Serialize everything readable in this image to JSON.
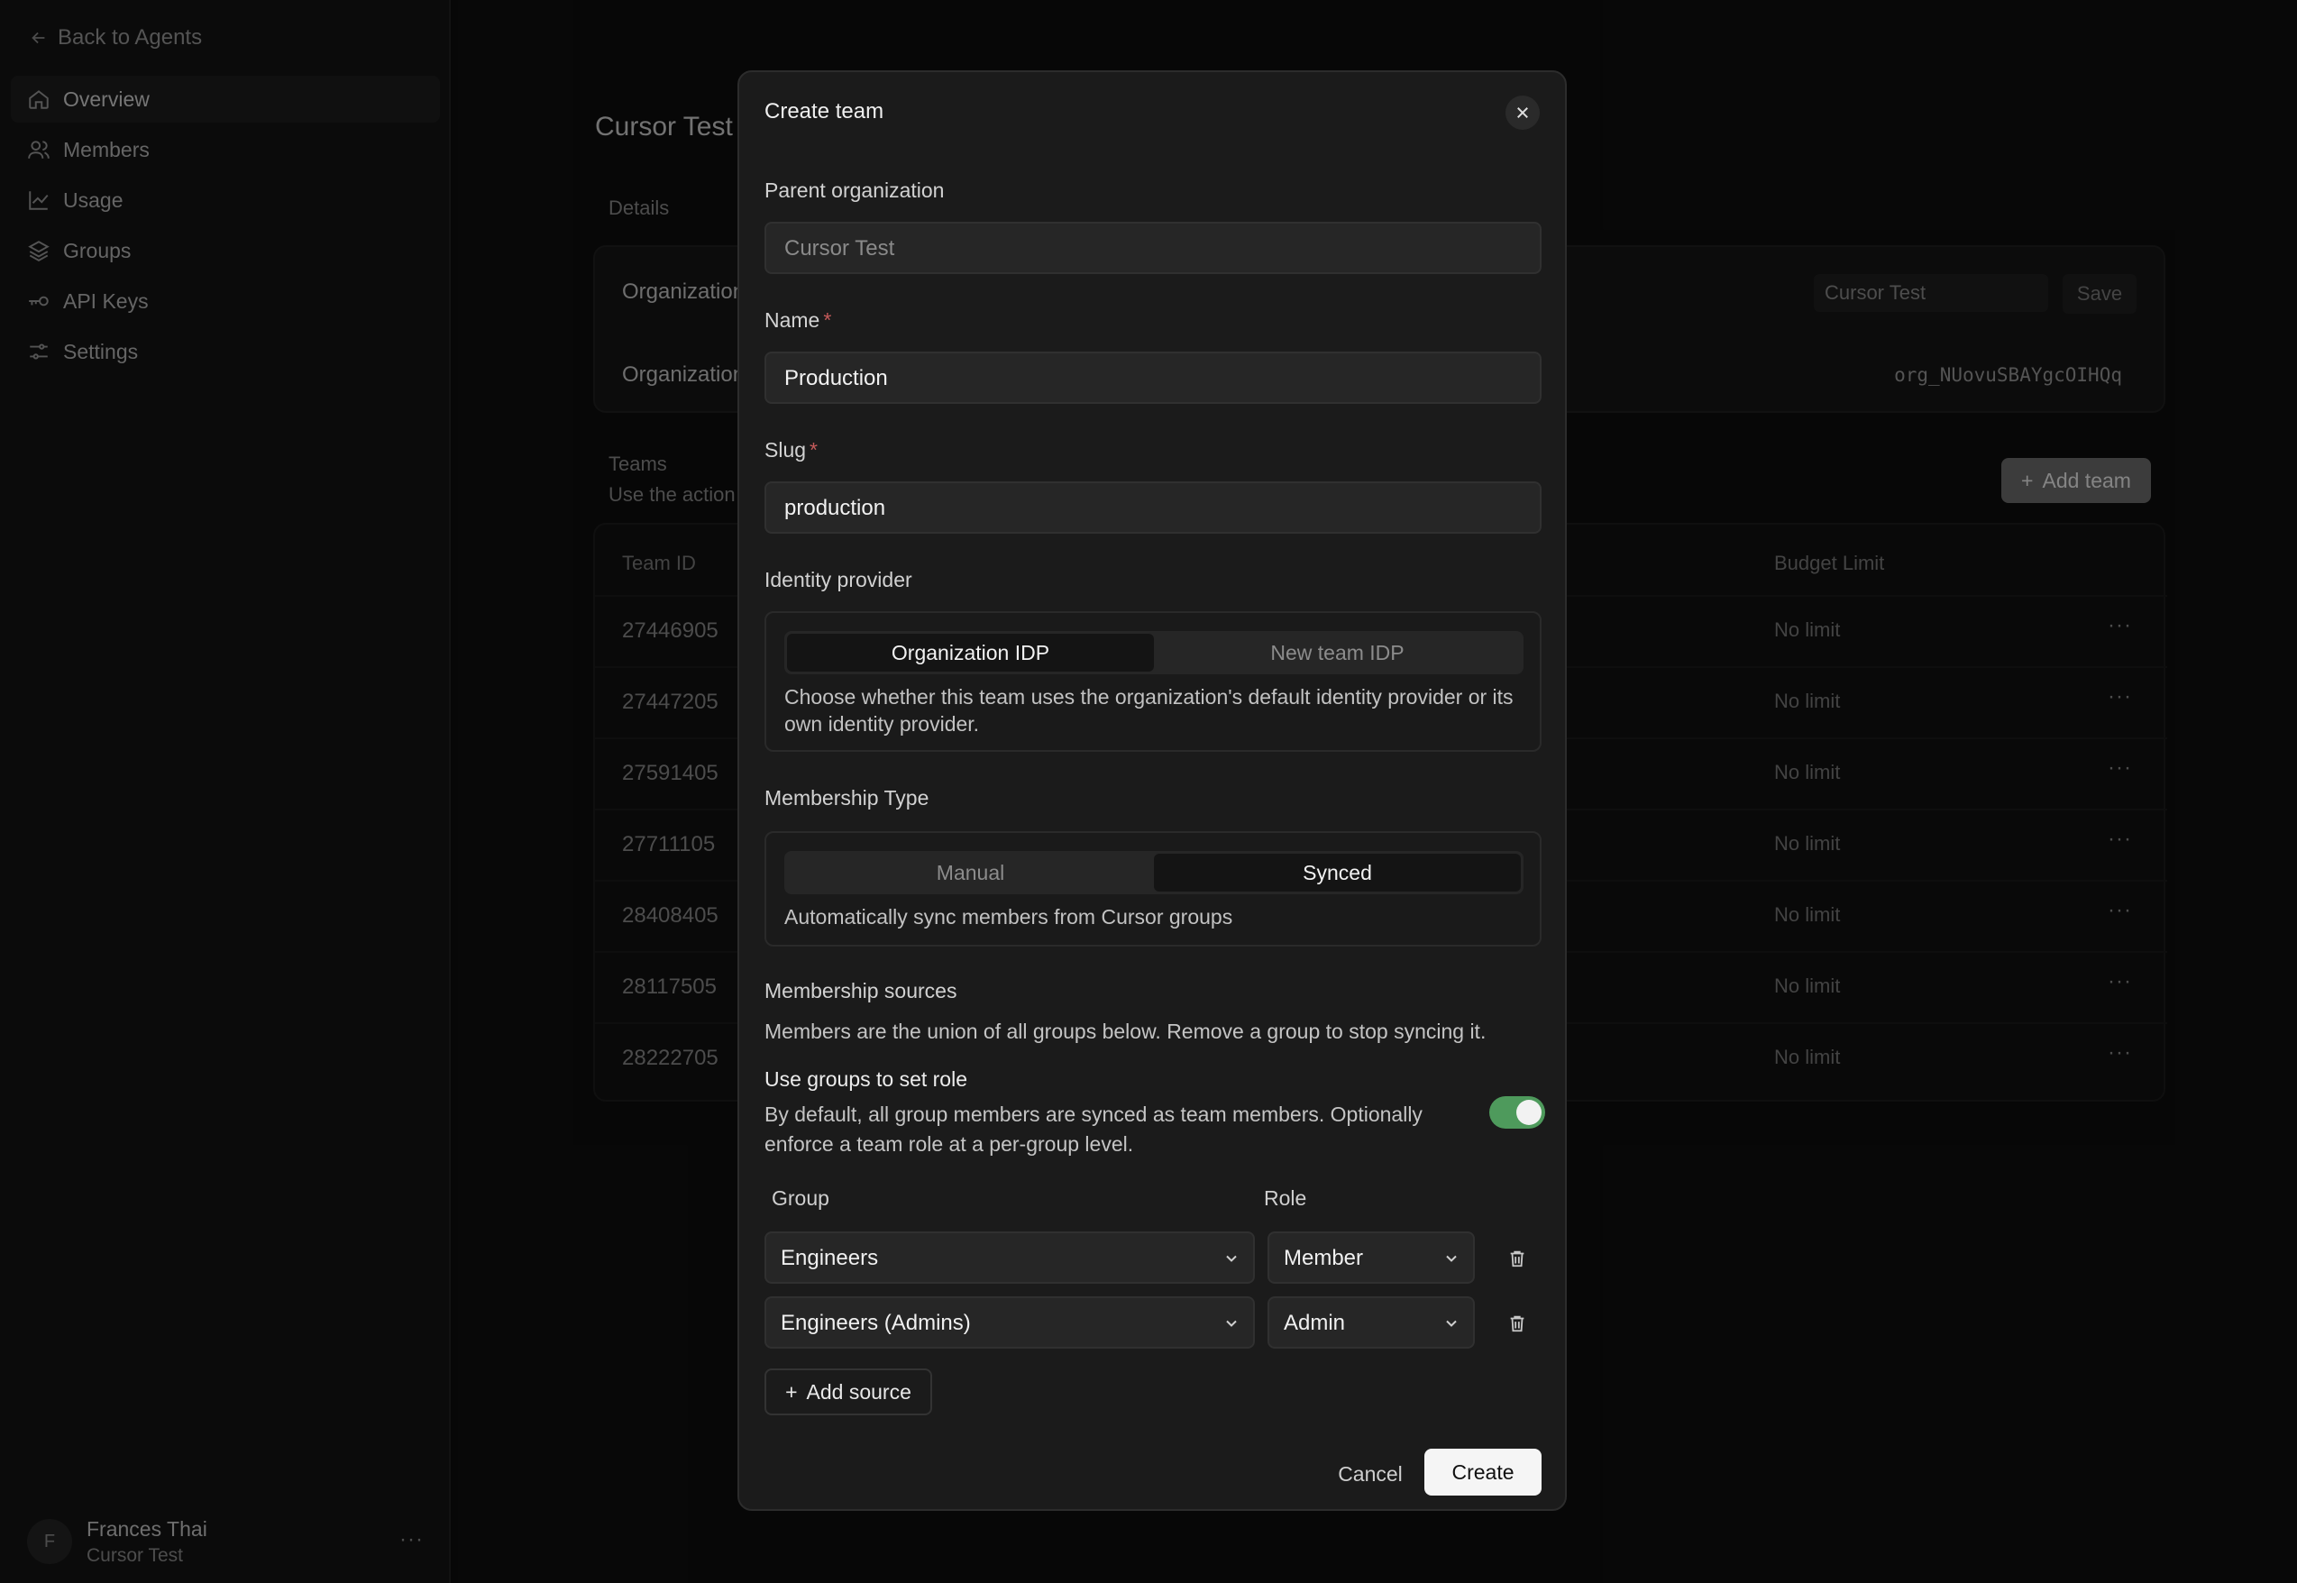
{
  "sidebar": {
    "back_label": "Back to Agents",
    "items": [
      {
        "label": "Overview",
        "icon": "home-icon"
      },
      {
        "label": "Members",
        "icon": "users-icon"
      },
      {
        "label": "Usage",
        "icon": "chart-icon"
      },
      {
        "label": "Groups",
        "icon": "layers-icon"
      },
      {
        "label": "API Keys",
        "icon": "key-icon"
      },
      {
        "label": "Settings",
        "icon": "sliders-icon"
      }
    ],
    "active_item": "Overview",
    "user": {
      "initial": "F",
      "name": "Frances Thai",
      "org": "Cursor Test",
      "more": "···"
    }
  },
  "main": {
    "title": "Cursor Test",
    "details_label": "Details",
    "org_name_label": "Organization",
    "org_id_label": "Organization",
    "org_name_value": "Cursor Test",
    "save_label": "Save",
    "org_id_value": "org_NUovuSBAYgcOIHQq",
    "teams_label": "Teams",
    "teams_desc": "Use the action",
    "add_team_label": "Add team",
    "columns": {
      "team_id": "Team ID",
      "budget": "Budget Limit"
    },
    "teams": [
      {
        "id": "27446905",
        "budget": "No limit"
      },
      {
        "id": "27447205",
        "budget": "No limit"
      },
      {
        "id": "27591405",
        "budget": "No limit"
      },
      {
        "id": "27711105",
        "budget": "No limit"
      },
      {
        "id": "28408405",
        "budget": "No limit"
      },
      {
        "id": "28117505",
        "budget": "No limit"
      },
      {
        "id": "28222705",
        "budget": "No limit"
      }
    ],
    "row_more": "···"
  },
  "modal": {
    "title": "Create team",
    "parent_org_label": "Parent organization",
    "parent_org_value": "Cursor Test",
    "name_label": "Name",
    "name_value": "Production",
    "slug_label": "Slug",
    "slug_value": "production",
    "required_mark": "*",
    "idp_label": "Identity provider",
    "idp_options": [
      "Organization IDP",
      "New team IDP"
    ],
    "idp_selected": "Organization IDP",
    "idp_help": "Choose whether this team uses the organization's default identity provider or its own identity provider.",
    "membership_label": "Membership Type",
    "membership_options": [
      "Manual",
      "Synced"
    ],
    "membership_selected": "Synced",
    "membership_help": "Automatically sync members from Cursor groups",
    "sources_label": "Membership sources",
    "sources_help": "Members are the union of all groups below. Remove a group to stop syncing it.",
    "role_toggle_label": "Use groups to set role",
    "role_toggle_help": "By default, all group members are synced as team members. Optionally enforce a team role at a per-group level.",
    "role_toggle_on": true,
    "group_col": "Group",
    "role_col": "Role",
    "sources": [
      {
        "group": "Engineers",
        "role": "Member"
      },
      {
        "group": "Engineers (Admins)",
        "role": "Admin"
      }
    ],
    "add_source_label": "Add source",
    "cancel_label": "Cancel",
    "create_label": "Create",
    "accent_color": "#4e9a5c"
  }
}
